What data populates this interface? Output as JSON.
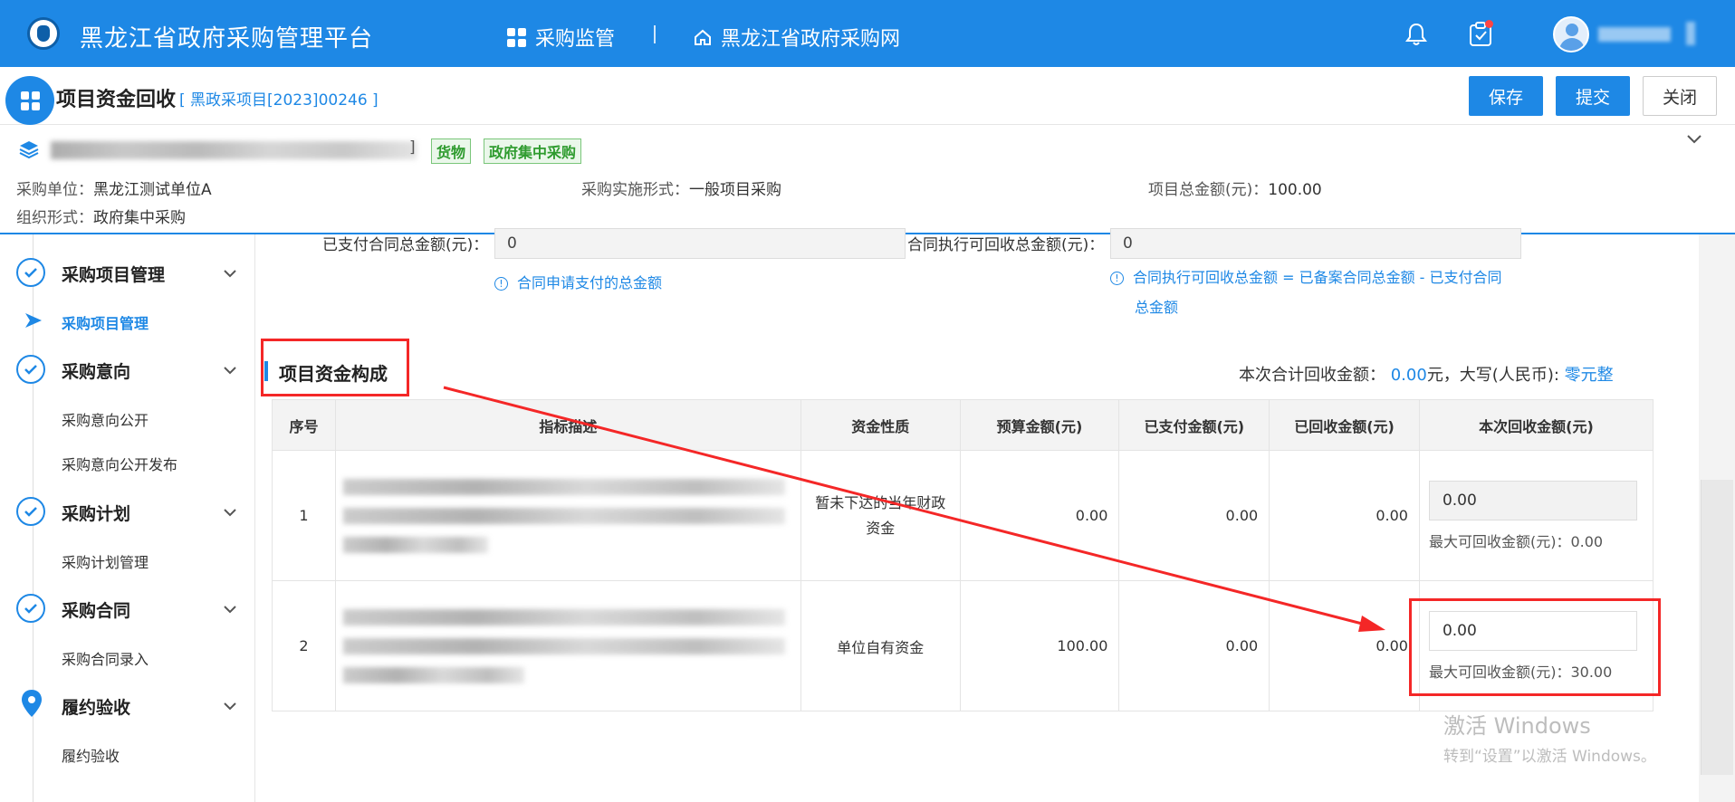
{
  "topbar": {
    "app_title": "黑龙江省政府采购管理平台",
    "nav": [
      {
        "label": "采购监管"
      },
      {
        "label": "黑龙江省政府采购网"
      }
    ]
  },
  "header": {
    "title": "项目资金回收",
    "project_code": "[ 黑政采项目[2023]00246 ]",
    "buttons": {
      "save": "保存",
      "submit": "提交",
      "close": "关闭"
    }
  },
  "project": {
    "name_suffix": "]",
    "tags": [
      "货物",
      "政府集中采购"
    ],
    "info": {
      "unit_label": "采购单位：",
      "unit_value": "黑龙江测试单位A",
      "form_label": "采购实施形式：",
      "form_value": "一般项目采购",
      "total_label": "项目总金额(元)：",
      "total_value": "100.00",
      "org_label": "组织形式：",
      "org_value": "政府集中采购"
    }
  },
  "sidebar": {
    "groups": [
      {
        "label": "采购项目管理",
        "items": [
          "采购项目管理"
        ]
      },
      {
        "label": "采购意向",
        "items": [
          "采购意向公开",
          "采购意向公开发布"
        ]
      },
      {
        "label": "采购计划",
        "items": [
          "采购计划管理"
        ]
      },
      {
        "label": "采购合同",
        "items": [
          "采购合同录入"
        ]
      },
      {
        "label": "履约验收",
        "items": [
          "履约验收"
        ]
      }
    ]
  },
  "form": {
    "paid_label": "已支付合同总金额(元)：",
    "paid_value": "0",
    "paid_hint": "合同申请支付的总金额",
    "recoverable_label": "合同执行可回收总金额(元)：",
    "recoverable_value": "0",
    "recoverable_hint_1": "合同执行可回收总金额 = 已备案合同总金额 - 已支付合同",
    "recoverable_hint_2": "总金额"
  },
  "section": {
    "title": "项目资金构成",
    "summary_prefix": "本次合计回收金额：",
    "summary_amount": "0.00",
    "summary_mid": "元，大写(人民币):",
    "summary_upper": "零元整"
  },
  "table": {
    "headers": [
      "序号",
      "指标描述",
      "资金性质",
      "预算金额(元)",
      "已支付金额(元)",
      "已回收金额(元)",
      "本次回收金额(元)"
    ],
    "rows": [
      {
        "no": "1",
        "nature": "暂未下达的当年财政资金",
        "budget": "0.00",
        "paid": "0.00",
        "recovered": "0.00",
        "return_value": "0.00",
        "max_label": "最大可回收金额(元)：",
        "max_value": "0.00"
      },
      {
        "no": "2",
        "nature": "单位自有资金",
        "budget": "100.00",
        "paid": "0.00",
        "recovered": "0.00",
        "return_value": "0.00",
        "max_label": "最大可回收金额(元)：",
        "max_value": "30.00"
      }
    ]
  },
  "watermark": {
    "line1": "激活 Windows",
    "line2": "转到“设置”以激活 Windows。"
  },
  "colors": {
    "primary": "#1e88e5",
    "highlight": "#f42727",
    "tag_green": "#2e9b2e"
  }
}
